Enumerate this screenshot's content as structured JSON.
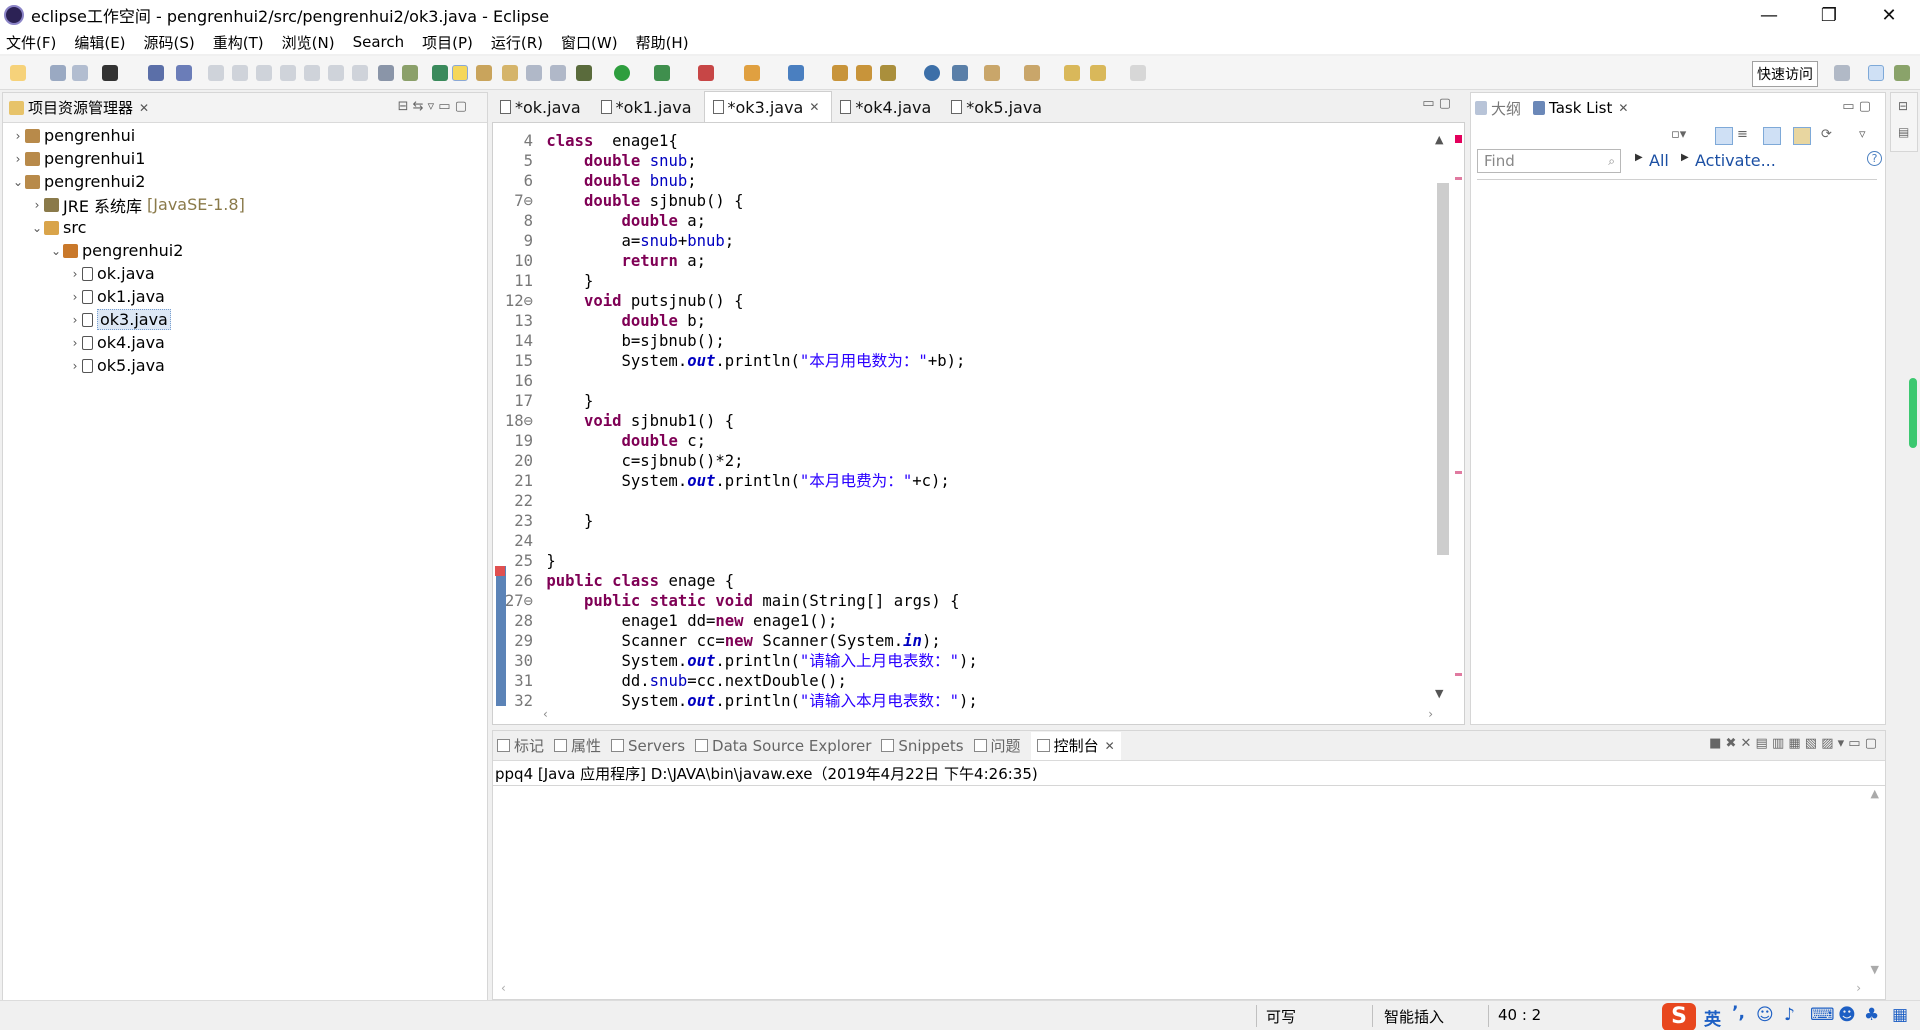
{
  "window": {
    "title": "eclipse工作空间 - pengrenhui2/src/pengrenhui2/ok3.java - Eclipse",
    "minimize": "—",
    "restore": "❐",
    "close": "✕"
  },
  "menu": [
    "文件(F)",
    "编辑(E)",
    "源码(S)",
    "重构(T)",
    "浏览(N)",
    "Search",
    "项目(P)",
    "运行(R)",
    "窗口(W)",
    "帮助(H)"
  ],
  "toolbar": {
    "quick_access": "快速访问"
  },
  "explorer": {
    "title": "项目资源管理器",
    "items": [
      {
        "label": "pengrenhui",
        "level": 0,
        "arrow": "›",
        "kind": "project"
      },
      {
        "label": "pengrenhui1",
        "level": 0,
        "arrow": "›",
        "kind": "project"
      },
      {
        "label": "pengrenhui2",
        "level": 0,
        "arrow": "⌄",
        "kind": "project"
      },
      {
        "label": "JRE 系统库",
        "extra": "[JavaSE-1.8]",
        "level": 1,
        "arrow": "›",
        "kind": "lib"
      },
      {
        "label": "src",
        "level": 1,
        "arrow": "⌄",
        "kind": "src"
      },
      {
        "label": "pengrenhui2",
        "level": 2,
        "arrow": "⌄",
        "kind": "pkg"
      },
      {
        "label": "ok.java",
        "level": 3,
        "arrow": "›",
        "kind": "java"
      },
      {
        "label": "ok1.java",
        "level": 3,
        "arrow": "›",
        "kind": "java"
      },
      {
        "label": "ok3.java",
        "level": 3,
        "arrow": "›",
        "kind": "java",
        "selected": true
      },
      {
        "label": "ok4.java",
        "level": 3,
        "arrow": "›",
        "kind": "java"
      },
      {
        "label": "ok5.java",
        "level": 3,
        "arrow": "›",
        "kind": "java"
      }
    ]
  },
  "editor": {
    "tabs": [
      {
        "label": "*ok.java",
        "active": false
      },
      {
        "label": "*ok1.java",
        "active": false
      },
      {
        "label": "*ok3.java",
        "active": true
      },
      {
        "label": "*ok4.java",
        "active": false
      },
      {
        "label": "*ok5.java",
        "active": false
      }
    ],
    "lines": [
      {
        "n": "4",
        "parts": [
          [
            "kw",
            "class"
          ],
          [
            "",
            "  enage1{"
          ]
        ]
      },
      {
        "n": "5",
        "parts": [
          [
            "",
            "    "
          ],
          [
            "kw",
            "double"
          ],
          [
            "",
            " "
          ],
          [
            "fld",
            "snub"
          ],
          [
            "",
            ";"
          ]
        ]
      },
      {
        "n": "6",
        "parts": [
          [
            "",
            "    "
          ],
          [
            "kw",
            "double"
          ],
          [
            "",
            " "
          ],
          [
            "fld",
            "bnub"
          ],
          [
            "",
            ";"
          ]
        ]
      },
      {
        "n": "7⊖",
        "parts": [
          [
            "",
            "    "
          ],
          [
            "kw",
            "double"
          ],
          [
            "",
            " sjbnub() {"
          ]
        ]
      },
      {
        "n": "8",
        "parts": [
          [
            "",
            "        "
          ],
          [
            "kw",
            "double"
          ],
          [
            "",
            " a;"
          ]
        ]
      },
      {
        "n": "9",
        "parts": [
          [
            "",
            "        a="
          ],
          [
            "fld",
            "snub"
          ],
          [
            "",
            "+"
          ],
          [
            "fld",
            "bnub"
          ],
          [
            "",
            ";"
          ]
        ]
      },
      {
        "n": "10",
        "parts": [
          [
            "",
            "        "
          ],
          [
            "kw",
            "return"
          ],
          [
            "",
            " a;"
          ]
        ]
      },
      {
        "n": "11",
        "parts": [
          [
            "",
            "    }"
          ]
        ]
      },
      {
        "n": "12⊖",
        "parts": [
          [
            "",
            "    "
          ],
          [
            "kw",
            "void"
          ],
          [
            "",
            " putsjnub() {"
          ]
        ]
      },
      {
        "n": "13",
        "parts": [
          [
            "",
            "        "
          ],
          [
            "kw",
            "double"
          ],
          [
            "",
            " b;"
          ]
        ]
      },
      {
        "n": "14",
        "parts": [
          [
            "",
            "        b=sjbnub();"
          ]
        ]
      },
      {
        "n": "15",
        "parts": [
          [
            "",
            "        System."
          ],
          [
            "itl",
            "out"
          ],
          [
            "",
            ".println("
          ],
          [
            "st",
            "\"本月用电数为：\""
          ],
          [
            "",
            "+b);"
          ]
        ]
      },
      {
        "n": "16",
        "parts": [
          [
            "",
            ""
          ]
        ]
      },
      {
        "n": "17",
        "parts": [
          [
            "",
            "    }"
          ]
        ]
      },
      {
        "n": "18⊖",
        "parts": [
          [
            "",
            "    "
          ],
          [
            "kw",
            "void"
          ],
          [
            "",
            " sjbnub1() {"
          ]
        ]
      },
      {
        "n": "19",
        "parts": [
          [
            "",
            "        "
          ],
          [
            "kw",
            "double"
          ],
          [
            "",
            " c;"
          ]
        ]
      },
      {
        "n": "20",
        "parts": [
          [
            "",
            "        c=sjbnub()*2;"
          ]
        ]
      },
      {
        "n": "21",
        "parts": [
          [
            "",
            "        System."
          ],
          [
            "itl",
            "out"
          ],
          [
            "",
            ".println("
          ],
          [
            "st",
            "\"本月电费为：\""
          ],
          [
            "",
            "+c);"
          ]
        ]
      },
      {
        "n": "22",
        "parts": [
          [
            "",
            ""
          ]
        ]
      },
      {
        "n": "23",
        "parts": [
          [
            "",
            "    }"
          ]
        ]
      },
      {
        "n": "24",
        "parts": [
          [
            "",
            ""
          ]
        ]
      },
      {
        "n": "25",
        "parts": [
          [
            "",
            "}"
          ]
        ]
      },
      {
        "n": "26",
        "parts": [
          [
            "kw",
            "public"
          ],
          [
            "",
            " "
          ],
          [
            "kw",
            "class"
          ],
          [
            "",
            " enage {"
          ]
        ]
      },
      {
        "n": "27⊖",
        "parts": [
          [
            "",
            "    "
          ],
          [
            "kw",
            "public"
          ],
          [
            "",
            " "
          ],
          [
            "kw",
            "static"
          ],
          [
            "",
            " "
          ],
          [
            "kw",
            "void"
          ],
          [
            "",
            " main(String[] args) {"
          ]
        ]
      },
      {
        "n": "28",
        "parts": [
          [
            "",
            "        enage1 dd="
          ],
          [
            "kw",
            "new"
          ],
          [
            "",
            " enage1();"
          ]
        ]
      },
      {
        "n": "29",
        "parts": [
          [
            "",
            "        Scanner cc="
          ],
          [
            "kw",
            "new"
          ],
          [
            "",
            " Scanner(System."
          ],
          [
            "itl",
            "in"
          ],
          [
            "",
            ");"
          ]
        ]
      },
      {
        "n": "30",
        "parts": [
          [
            "",
            "        System."
          ],
          [
            "itl",
            "out"
          ],
          [
            "",
            ".println("
          ],
          [
            "st",
            "\"请输入上月电表数：\""
          ],
          [
            "",
            ");"
          ]
        ]
      },
      {
        "n": "31",
        "parts": [
          [
            "",
            "        dd."
          ],
          [
            "fld",
            "snub"
          ],
          [
            "",
            "=cc.nextDouble();"
          ]
        ]
      },
      {
        "n": "32",
        "parts": [
          [
            "",
            "        System."
          ],
          [
            "itl",
            "out"
          ],
          [
            "",
            ".println("
          ],
          [
            "st",
            "\"请输入本月电表数：\""
          ],
          [
            "",
            ");"
          ]
        ]
      }
    ]
  },
  "outline": {
    "tabs": [
      "大纲",
      "Task List"
    ],
    "find_placeholder": "Find",
    "all": "All",
    "activate": "Activate...",
    "help": "?"
  },
  "console": {
    "tabs": [
      "标记",
      "属性",
      "Servers",
      "Data Source Explorer",
      "Snippets",
      "问题",
      "控制台"
    ],
    "header": "ppq4 [Java 应用程序] D:\\JAVA\\bin\\javaw.exe（2019年4月22日 下午4:26:35)"
  },
  "status": {
    "writable": "可写",
    "insert": "智能插入",
    "position": "40 : 2"
  },
  "ime": {
    "lang": "英",
    "punct": "’,"
  },
  "colors": {
    "keyword": "#7f0055",
    "field": "#0000c0",
    "string": "#2a00ff",
    "selection": "#dde8f5"
  }
}
